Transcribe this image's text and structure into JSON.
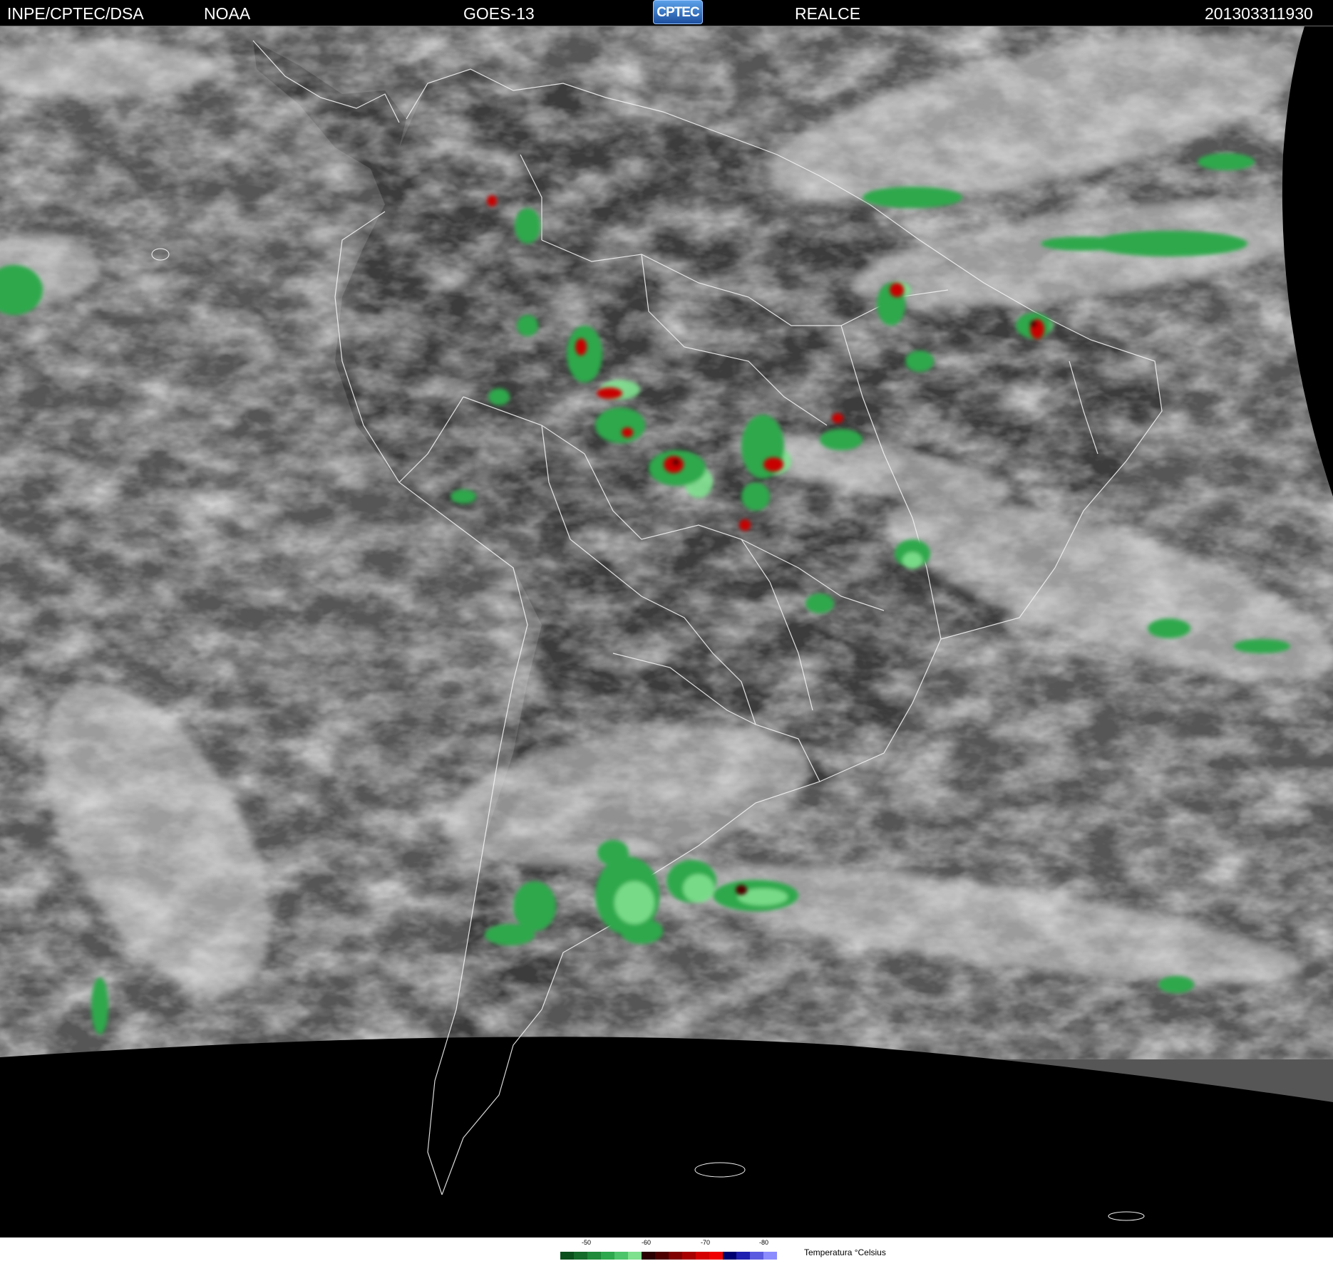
{
  "header": {
    "org": "INPE/CPTEC/DSA",
    "agency": "NOAA",
    "satellite": "GOES-13",
    "logo_text": "CPTEC",
    "product": "REALCE",
    "timestamp": "201303311930"
  },
  "legend": {
    "title": "Temperatura °Celsius",
    "ticks": [
      "-50",
      "-60",
      "-70",
      "-80"
    ],
    "colors": [
      "#0a4f1c",
      "#156b2a",
      "#1f8a3a",
      "#2ea84c",
      "#4cc46a",
      "#7fe08e",
      "#2a0000",
      "#4d0000",
      "#800000",
      "#a80000",
      "#d40000",
      "#f00000",
      "#000070",
      "#2020b0",
      "#5a5ae0",
      "#8c8cff"
    ]
  }
}
